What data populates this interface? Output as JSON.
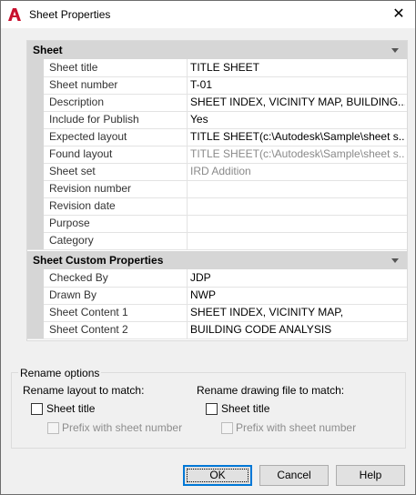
{
  "window": {
    "title": "Sheet Properties",
    "close_glyph": "✕",
    "app_icon": "autocad-logo-icon",
    "accent_color": "#c8102e"
  },
  "grid": {
    "sheet": {
      "header": "Sheet",
      "rows": [
        {
          "name": "Sheet title",
          "value": "TITLE SHEET"
        },
        {
          "name": "Sheet number",
          "value": "T-01"
        },
        {
          "name": "Description",
          "value": "SHEET INDEX,  VICINITY MAP,  BUILDING..."
        },
        {
          "name": "Include for Publish",
          "value": "Yes"
        },
        {
          "name": "Expected layout",
          "value": "TITLE  SHEET(c:\\Autodesk\\Sample\\sheet  s..."
        },
        {
          "name": "Found layout",
          "value": "TITLE  SHEET(c:\\Autodesk\\Sample\\sheet  s..."
        },
        {
          "name": "Sheet set",
          "value": "IRD Addition"
        },
        {
          "name": "Revision number",
          "value": ""
        },
        {
          "name": "Revision date",
          "value": ""
        },
        {
          "name": "Purpose",
          "value": ""
        },
        {
          "name": "Category",
          "value": ""
        }
      ]
    },
    "custom": {
      "header": "Sheet Custom Properties",
      "rows": [
        {
          "name": "Checked By",
          "value": "JDP"
        },
        {
          "name": "Drawn By",
          "value": "NWP"
        },
        {
          "name": "Sheet Content 1",
          "value": "SHEET INDEX, VICINITY MAP,"
        },
        {
          "name": "Sheet Content 2",
          "value": "BUILDING CODE ANALYSIS"
        }
      ]
    }
  },
  "rename": {
    "legend": "Rename options",
    "layout_label": "Rename layout to match:",
    "drawing_label": "Rename drawing file to match:",
    "layout_sheet_title": "Sheet title",
    "layout_prefix": "Prefix with sheet number",
    "drawing_sheet_title": "Sheet title",
    "drawing_prefix": "Prefix with sheet number"
  },
  "buttons": {
    "ok": "OK",
    "cancel": "Cancel",
    "help": "Help"
  }
}
